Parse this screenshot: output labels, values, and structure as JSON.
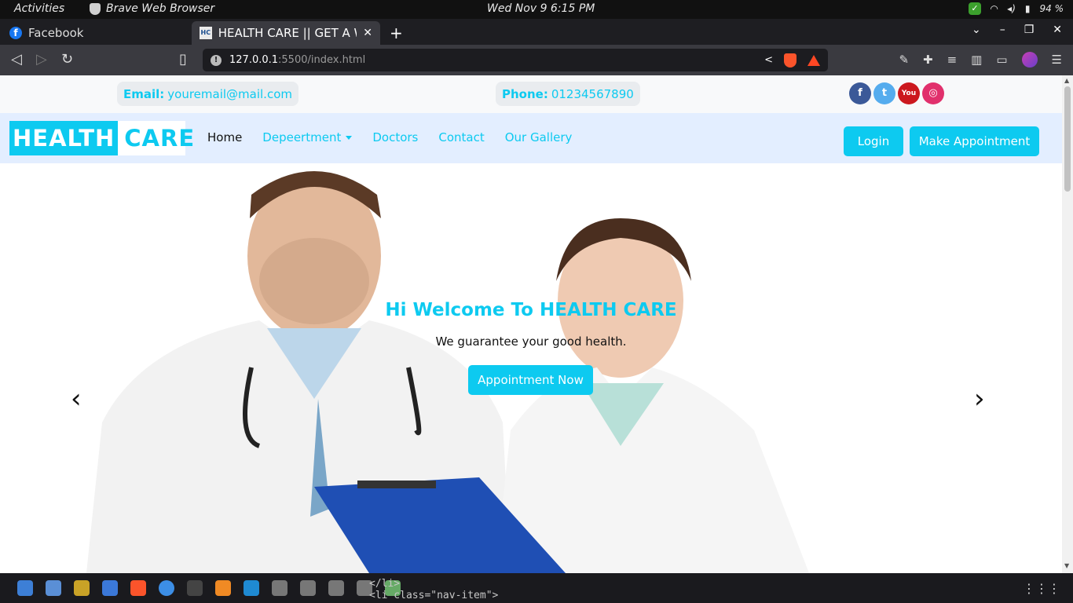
{
  "system": {
    "activities": "Activities",
    "app_name": "Brave Web Browser",
    "clock": "Wed Nov 9  6:15 PM",
    "battery": "94 %"
  },
  "browser": {
    "tabs": [
      {
        "title": "Facebook",
        "active": false
      },
      {
        "title": "HEALTH CARE || GET A WO",
        "active": true
      }
    ],
    "url_host": "127.0.0.1",
    "url_rest": ":5500/index.html"
  },
  "page": {
    "contact": {
      "email_label": "Email:",
      "email_value": "youremail@mail.com",
      "phone_label": "Phone:",
      "phone_value": "01234567890"
    },
    "socials": [
      "f",
      "t",
      "You Tube",
      "ig"
    ],
    "logo": {
      "part1": "HEALTH",
      "part2": "CARE"
    },
    "nav": {
      "home": "Home",
      "department": "Depeertment",
      "doctors": "Doctors",
      "contact": "Contact",
      "gallery": "Our Gallery"
    },
    "login_label": "Login",
    "appointment_label": "Make Appointment",
    "hero": {
      "title": "Hi Welcome To HEALTH CARE",
      "subtitle": "We guarantee your good health.",
      "cta": "Appointment Now",
      "prev": "‹",
      "next": "›"
    }
  },
  "dock_code": {
    "line1": "</li>",
    "line2": "<li class=\"nav-item\">"
  },
  "colors": {
    "accent": "#0dcaf0",
    "navbar_bg": "#e3eeff"
  }
}
